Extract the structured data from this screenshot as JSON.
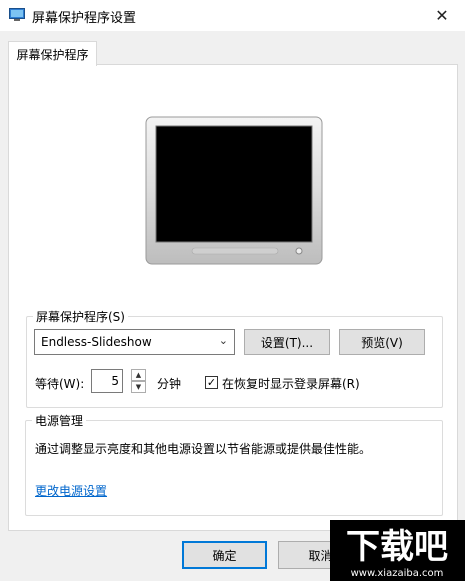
{
  "window": {
    "title": "屏幕保护程序设置",
    "close_symbol": "✕"
  },
  "tabs": [
    {
      "label": "屏幕保护程序"
    }
  ],
  "screensaver_group": {
    "legend": "屏幕保护程序(S)",
    "selected": "Endless-Slideshow",
    "settings_button": "设置(T)...",
    "preview_button": "预览(V)",
    "wait_label": "等待(W):",
    "wait_value": "5",
    "minutes_label": "分钟",
    "resume_checkbox_label": "在恢复时显示登录屏幕(R)",
    "resume_checked": true
  },
  "power_group": {
    "legend": "电源管理",
    "description": "通过调整显示亮度和其他电源设置以节省能源或提供最佳性能。",
    "link": "更改电源设置"
  },
  "footer": {
    "ok_button": "确定",
    "cancel_button": "取消"
  },
  "watermark": {
    "text": "下载吧",
    "url": "www.xiazaiba.com"
  }
}
